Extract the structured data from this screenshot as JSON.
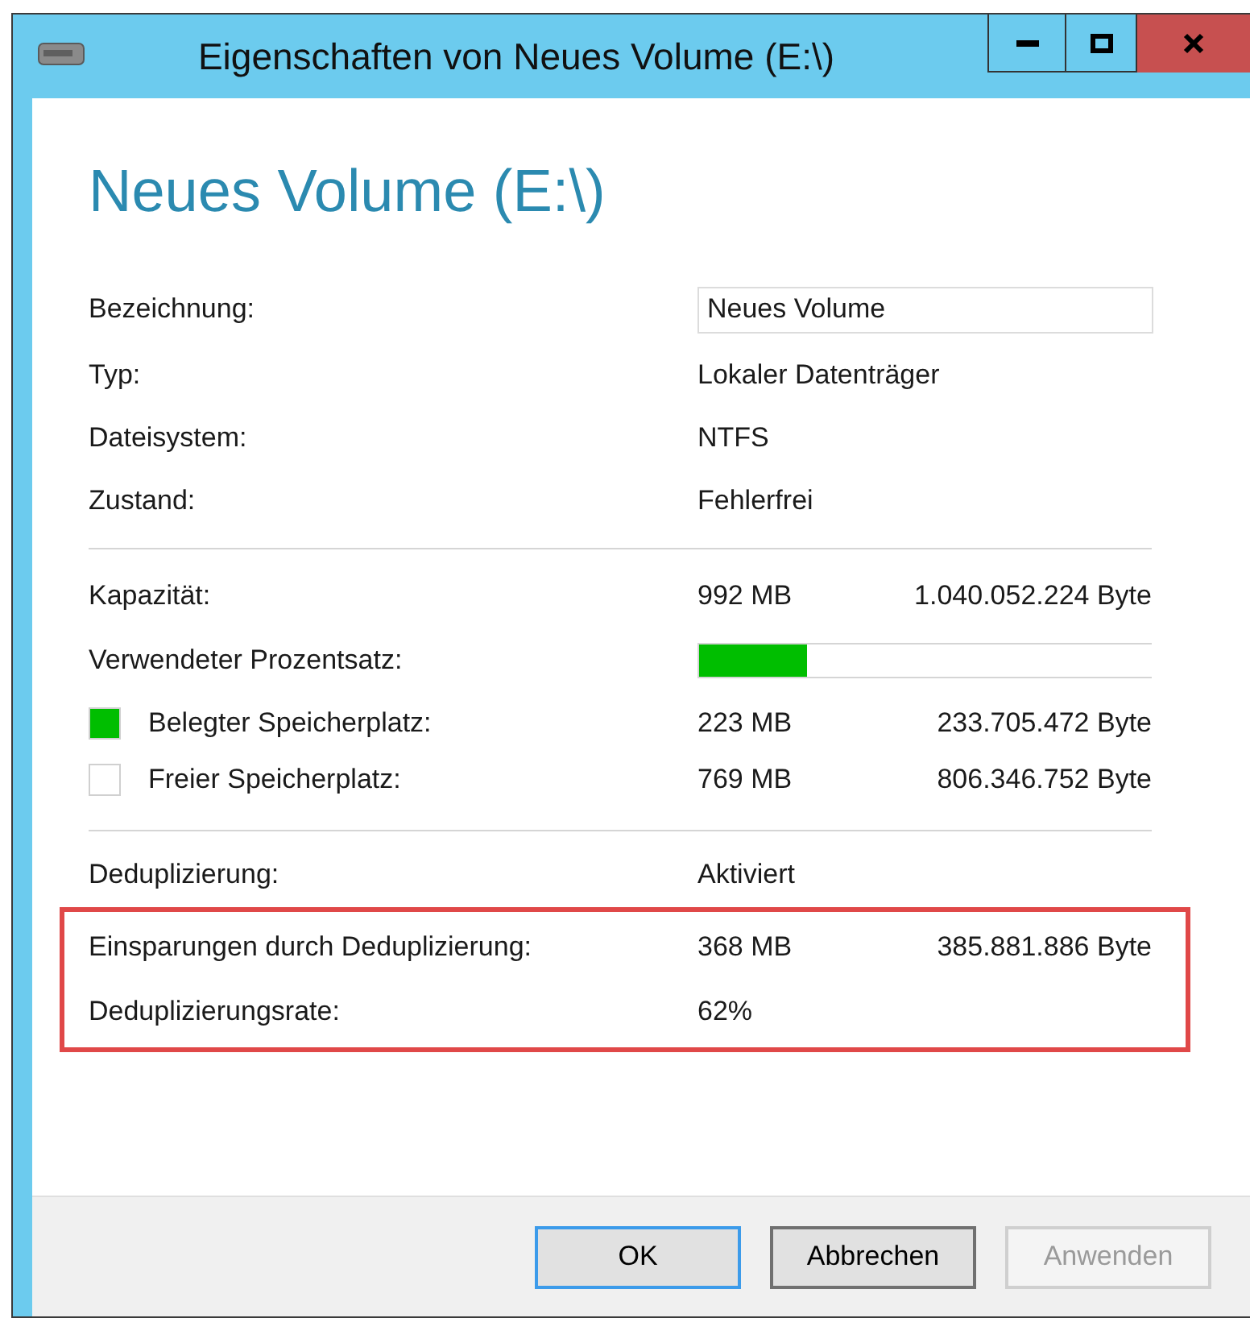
{
  "window": {
    "title": "Eigenschaften von Neues Volume (E:\\)"
  },
  "heading": "Neues Volume (E:\\)",
  "label_field": {
    "label": "Bezeichnung:",
    "value": "Neues Volume"
  },
  "info": [
    {
      "label": "Typ:",
      "value": "Lokaler Datenträger"
    },
    {
      "label": "Dateisystem:",
      "value": "NTFS"
    },
    {
      "label": "Zustand:",
      "value": "Fehlerfrei"
    }
  ],
  "capacity": {
    "label": "Kapazität:",
    "size": "992 MB",
    "bytes": "1.040.052.224 Byte"
  },
  "usage": {
    "label": "Verwendeter Prozentsatz:",
    "level": 0.24
  },
  "legend": [
    {
      "label": "Belegter Speicherplatz:",
      "color": "#00be00",
      "size": "223 MB",
      "bytes": "233.705.472 Byte"
    },
    {
      "label": "Freier Speicherplatz:",
      "color": "#ffffff",
      "size": "769 MB",
      "bytes": "806.346.752 Byte"
    }
  ],
  "dedup": {
    "label": "Deduplizierung:",
    "value": "Aktiviert"
  },
  "highlighted": [
    {
      "label": "Einsparungen durch Deduplizierung:",
      "size": "368 MB",
      "bytes": "385.881.886 Byte"
    },
    {
      "label": "Deduplizierungsrate:",
      "size": "62%"
    }
  ],
  "buttons": [
    {
      "label": "OK",
      "kind": "default",
      "disabled": false
    },
    {
      "label": "Abbrechen",
      "kind": "focused",
      "disabled": false
    },
    {
      "label": "Anwenden",
      "kind": "normal",
      "disabled": true
    }
  ]
}
